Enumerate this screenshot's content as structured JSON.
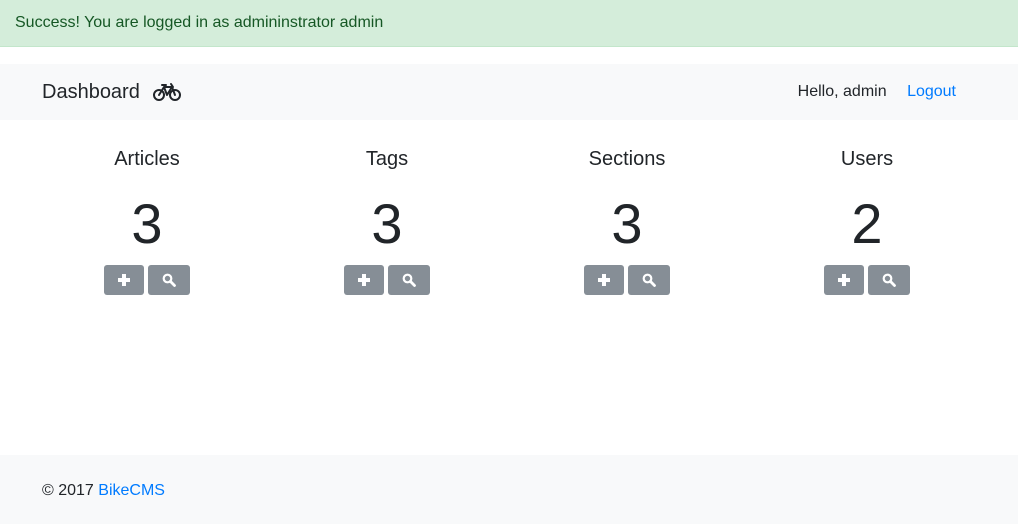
{
  "alert": {
    "text": "Success! You are logged in as admininstrator admin"
  },
  "navbar": {
    "brand": "Dashboard",
    "brand_icon": "bicycle-icon",
    "greeting": "Hello, admin",
    "logout_label": "Logout"
  },
  "stats": [
    {
      "title": "Articles",
      "count": "3"
    },
    {
      "title": "Tags",
      "count": "3"
    },
    {
      "title": "Sections",
      "count": "3"
    },
    {
      "title": "Users",
      "count": "2"
    }
  ],
  "buttons": {
    "add_icon": "plus-icon",
    "search_icon": "search-icon"
  },
  "footer": {
    "copyright": "© 2017",
    "link_label": "BikeCMS"
  },
  "colors": {
    "alert_bg": "#d4edda",
    "alert_text": "#155724",
    "link": "#007bff",
    "button_bg": "#868e96",
    "bar_bg": "#f8f9fa"
  }
}
